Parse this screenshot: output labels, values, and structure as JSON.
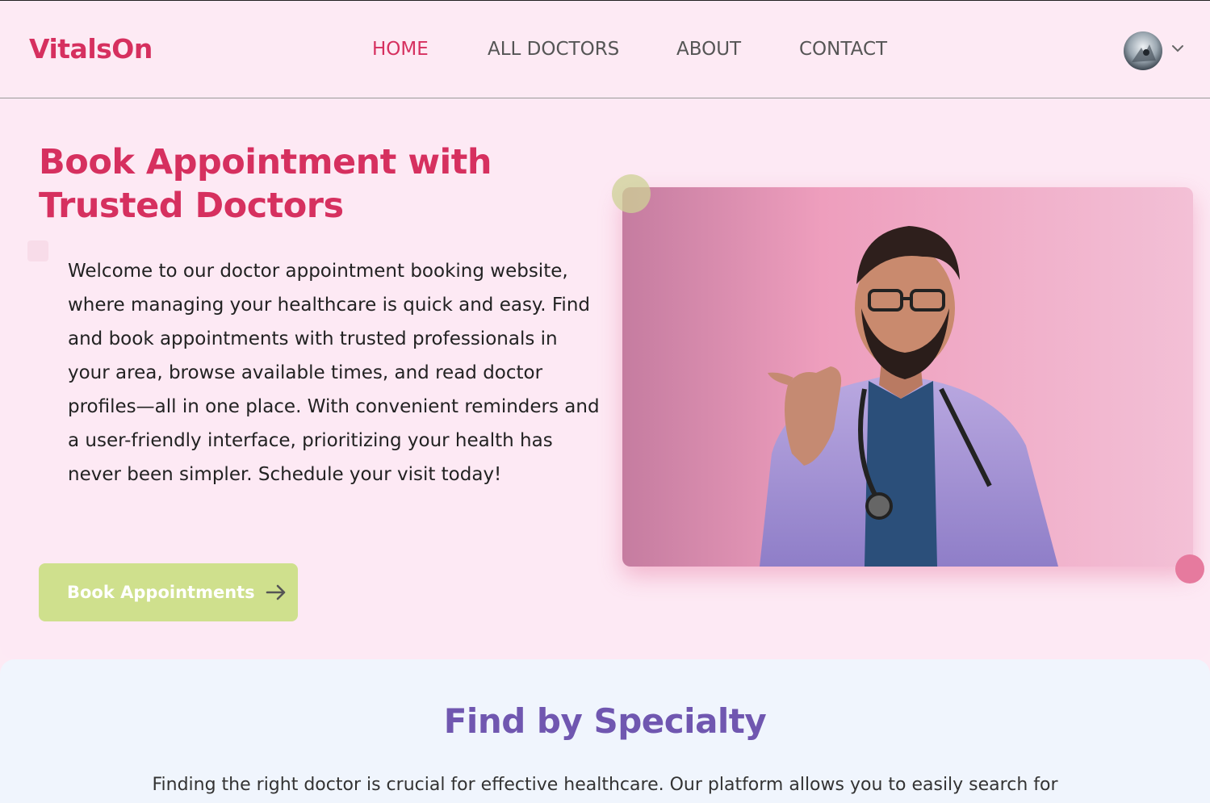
{
  "header": {
    "brand": "VitalsOn",
    "nav": [
      {
        "label": "HOME",
        "active": true
      },
      {
        "label": "ALL DOCTORS",
        "active": false
      },
      {
        "label": "ABOUT",
        "active": false
      },
      {
        "label": "CONTACT",
        "active": false
      }
    ],
    "avatar_icon": "user-avatar-icon",
    "dropdown_icon": "chevron-down-icon"
  },
  "hero": {
    "title": "Book Appointment with Trusted Doctors",
    "description": "Welcome to our doctor appointment booking website, where managing your healthcare is quick and easy. Find and book appointments with trusted professionals in your area, browse available times, and read doctor profiles—all in one place. With convenient reminders and a user-friendly interface, prioritizing your health has never been simpler. Schedule your visit today!",
    "cta_label": "Book Appointments",
    "cta_icon": "arrow-right-icon",
    "image_icon": "doctor-photo"
  },
  "specialty": {
    "title": "Find by Specialty",
    "description": "Finding the right doctor is crucial for effective healthcare. Our platform allows you to easily search for"
  },
  "colors": {
    "accent": "#d6305f",
    "cta": "#cfe08d",
    "section_title": "#7057b0",
    "hero_bg": "#fde9f4",
    "section_bg": "#f0f5fd"
  }
}
